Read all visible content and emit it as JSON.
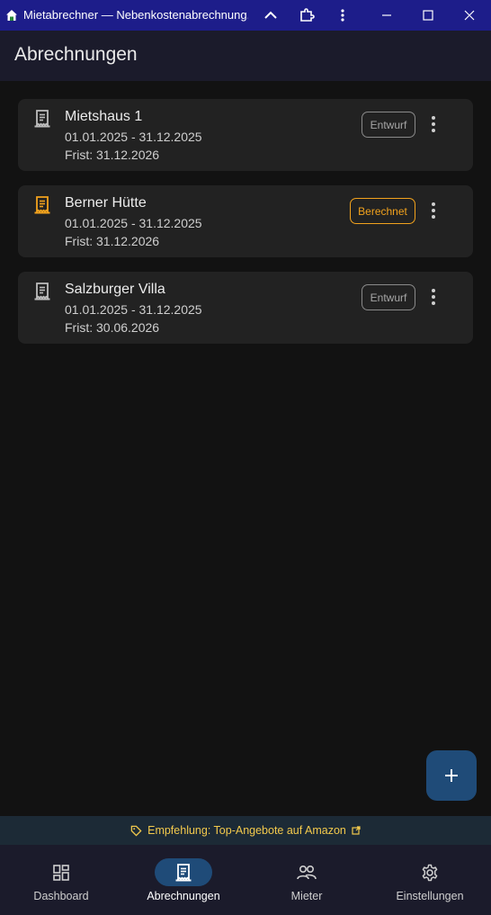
{
  "window": {
    "title": "Mietabrechner — Nebenkostenabrechnung...",
    "controls": [
      "chevron-up-icon",
      "extension-icon",
      "more-vert-icon",
      "minimize-icon",
      "maximize-icon",
      "close-icon"
    ]
  },
  "appbar": {
    "title": "Abrechnungen"
  },
  "statements": [
    {
      "title": "Mietshaus 1",
      "period": "01.01.2025 - 31.12.2025",
      "deadline": "Frist: 31.12.2026",
      "status": "Entwurf",
      "status_type": "draft",
      "icon": "receipt-icon"
    },
    {
      "title": "Berner Hütte",
      "period": "01.01.2025 - 31.12.2025",
      "deadline": "Frist: 31.12.2026",
      "status": "Berechnet",
      "status_type": "calculated",
      "icon": "receipt-icon"
    },
    {
      "title": "Salzburger Villa",
      "period": "01.01.2025 - 31.12.2025",
      "deadline": "Frist: 30.06.2026",
      "status": "Entwurf",
      "status_type": "draft",
      "icon": "receipt-icon"
    }
  ],
  "fab": {
    "icon": "plus-icon"
  },
  "promo": {
    "text": "Empfehlung: Top-Angebote auf Amazon"
  },
  "nav": {
    "items": [
      {
        "label": "Dashboard",
        "icon": "dashboard-icon",
        "active": false
      },
      {
        "label": "Abrechnungen",
        "icon": "receipt-icon",
        "active": true
      },
      {
        "label": "Mieter",
        "icon": "people-icon",
        "active": false
      },
      {
        "label": "Einstellungen",
        "icon": "gear-icon",
        "active": false
      }
    ]
  },
  "colors": {
    "titlebar": "#1d1d8a",
    "appbar": "#1b1b2b",
    "background": "#121212",
    "card": "#222222",
    "accent": "#1f4b78",
    "calculated": "#f2a21d",
    "promo_text": "#f2c94c"
  }
}
